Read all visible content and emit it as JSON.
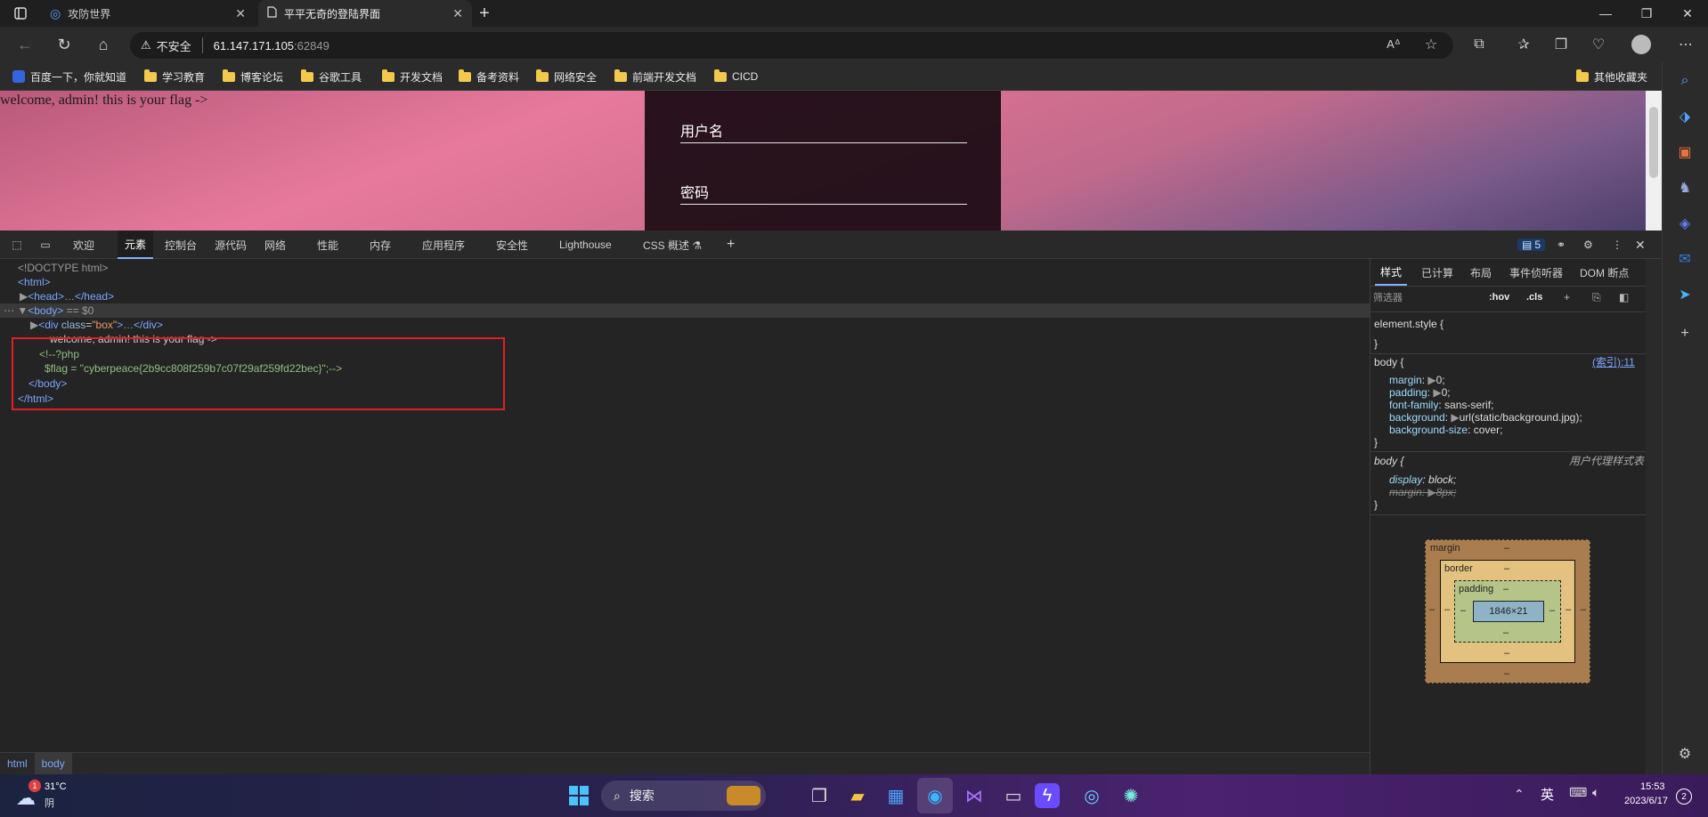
{
  "browser": {
    "tabs": [
      {
        "label": "攻防世界",
        "active": false
      },
      {
        "label": "平平无奇的登陆界面",
        "active": true
      }
    ],
    "new_tab": "+",
    "window_controls": {
      "minimize": "—",
      "restore": "❐",
      "close": "✕"
    },
    "address": {
      "security_label": "不安全",
      "host": "61.147.171.105",
      "port": ":62849"
    },
    "bookmarks": [
      {
        "label": "百度一下，你就知道",
        "type": "site"
      },
      {
        "label": "学习教育",
        "type": "folder"
      },
      {
        "label": "博客论坛",
        "type": "folder"
      },
      {
        "label": "谷歌工具",
        "type": "folder"
      },
      {
        "label": "开发文档",
        "type": "folder"
      },
      {
        "label": "备考资料",
        "type": "folder"
      },
      {
        "label": "网络安全",
        "type": "folder"
      },
      {
        "label": "前端开发文档",
        "type": "folder"
      },
      {
        "label": "CICD",
        "type": "folder"
      }
    ],
    "other_bookmarks": "其他收藏夹"
  },
  "page": {
    "flag_text": "welcome, admin! this is your flag ->",
    "username_label": "用户名",
    "password_label": "密码"
  },
  "devtools": {
    "tabs": [
      "欢迎",
      "元素",
      "控制台",
      "源代码",
      "网络",
      "性能",
      "内存",
      "应用程序",
      "安全性",
      "Lighthouse",
      "CSS 概述 ⚗"
    ],
    "active_tab": "元素",
    "issues_count": "5",
    "dom": {
      "doctype": "<!DOCTYPE html>",
      "html_open": "<html>",
      "head": "<head>",
      "head_close": "</head>",
      "body_open": "<body>",
      "body_marker": "== $0",
      "div_open": "<div ",
      "div_attr_name": "class",
      "div_attr_value": "\"box\"",
      "div_close": "</div>",
      "text_node": "welcome, admin! this is your flag ->",
      "comment_1": "<!--?php",
      "comment_2": "$flag = \"cyberpeace{2b9cc808f259b7c07f29af259fd22bec}\";-->",
      "body_close": "</body>",
      "html_close": "</html>"
    },
    "breadcrumbs": [
      "html",
      "body"
    ],
    "styles": {
      "tabs": [
        "样式",
        "已计算",
        "布局",
        "事件侦听器",
        "DOM 断点"
      ],
      "filter_placeholder": "筛选器",
      "hov": ":hov",
      "cls": ".cls",
      "element_style": "element.style {",
      "rule_body_selector": "body {",
      "rule_body_source": "(索引):11",
      "rule_body_props": [
        {
          "name": "margin",
          "value": "0;"
        },
        {
          "name": "padding",
          "value": "0;"
        },
        {
          "name": "font-family",
          "value": "sans-serif;"
        },
        {
          "name": "background",
          "value": "url(static/background.jpg);"
        },
        {
          "name": "background-size",
          "value": "cover;"
        }
      ],
      "ua_selector": "body {",
      "ua_source": "用户代理样式表",
      "ua_props": [
        {
          "name": "display",
          "value": "block;"
        },
        {
          "name": "margin",
          "value": "8px;"
        }
      ],
      "close_brace": "}"
    },
    "box_model": {
      "margin_label": "margin",
      "border_label": "border",
      "padding_label": "padding",
      "content": "1846×21",
      "dash": "–"
    }
  },
  "taskbar": {
    "weather_temp": "31°C",
    "weather_desc": "阴",
    "weather_badge": "1",
    "search_label": "搜索",
    "ime": "英",
    "time": "15:53",
    "date": "2023/6/17",
    "notifications": "2"
  }
}
